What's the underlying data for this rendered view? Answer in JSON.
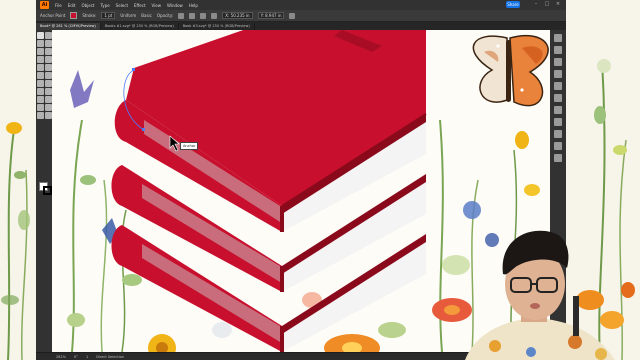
{
  "app": {
    "logo": "Ai",
    "menu": [
      "File",
      "Edit",
      "Object",
      "Type",
      "Select",
      "Effect",
      "View",
      "Window",
      "Help"
    ],
    "share_label": "Share",
    "window_controls": [
      "–",
      "□",
      "×"
    ]
  },
  "controlbar": {
    "selection_label": "Anchor Point",
    "stroke_label": "Stroke:",
    "stroke_value": "1 pt",
    "uniform_label": "Uniform",
    "basic_label": "Basic",
    "opacity_label": "Opacity:",
    "x_value": "X: 50.235 in",
    "y_value": "Y: 8.947 in"
  },
  "tabs": [
    {
      "label": "Book* @ 281 % (CMYK/Preview)",
      "active": true
    },
    {
      "label": "Books #1.svg* @ 250 % (RGB/Preview)",
      "active": false
    },
    {
      "label": "Book #3.svg* @ 250 % (RGB/Preview)",
      "active": false
    }
  ],
  "tooltip": "Anchor",
  "status": {
    "zoom": "281%",
    "rotation": "0°",
    "page": "1",
    "tool": "Direct Selection"
  },
  "colors": {
    "book_red": "#c8102e",
    "book_red_dark": "#8a0a1c",
    "page_white": "#f4f4f4",
    "page_shade": "#c9c9c9",
    "accent": "#1473e6"
  },
  "icons": [
    "illustrator-logo",
    "selection-tool-icon",
    "pen-tool-icon",
    "type-tool-icon",
    "shape-tool-icon",
    "brush-tool-icon",
    "zoom-tool-icon",
    "hand-tool-icon",
    "properties-icon",
    "layers-icon",
    "libraries-icon"
  ]
}
